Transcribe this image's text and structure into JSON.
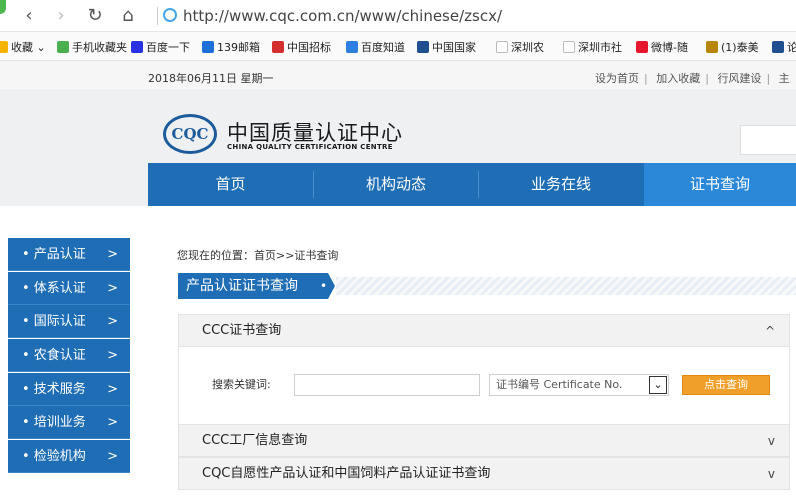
{
  "browser": {
    "url": "http://www.cqc.com.cn/www/chinese/zscx/",
    "back_glyph": "‹",
    "forward_glyph": "›",
    "refresh_glyph": "↻",
    "home_glyph": "⌂"
  },
  "favorites": [
    {
      "label": "收藏",
      "icon": "star-icon",
      "color": "#f4b400"
    },
    {
      "label": "手机收藏夹",
      "icon": "phone-icon",
      "color": "#4caf50"
    },
    {
      "label": "百度一下",
      "icon": "baidu-icon",
      "color": "#2932e1"
    },
    {
      "label": "139邮箱",
      "icon": "mail-icon",
      "color": "#1e6fd9"
    },
    {
      "label": "中国招标",
      "icon": "flag-icon",
      "color": "#d32f2f"
    },
    {
      "label": "百度知道",
      "icon": "paw-icon",
      "color": "#2f7fe0"
    },
    {
      "label": "中国国家",
      "icon": "site-icon",
      "color": "#1f4f8f"
    },
    {
      "label": "深圳农",
      "icon": "page-icon",
      "color": "#bbbbbb"
    },
    {
      "label": "深圳市社",
      "icon": "page-icon",
      "color": "#bbbbbb"
    },
    {
      "label": "微博-随",
      "icon": "weibo-icon",
      "color": "#e6162d"
    },
    {
      "label": "(1)泰美",
      "icon": "site-icon",
      "color": "#b8860b"
    },
    {
      "label": "论",
      "icon": "site-icon",
      "color": "#1f4f8f"
    }
  ],
  "topstrip": {
    "date": "2018年06月11日  星期一",
    "links": [
      "设为首页",
      "加入收藏",
      "行风建设",
      "主"
    ]
  },
  "logo": {
    "mark": "CQC",
    "name_cn": "中国质量认证中心",
    "name_en": "CHINA QUALITY CERTIFICATION CENTRE"
  },
  "mainnav": [
    {
      "label": "首页"
    },
    {
      "label": "机构动态"
    },
    {
      "label": "业务在线"
    },
    {
      "label": "证书查询",
      "active": true
    }
  ],
  "sidebar": {
    "items": [
      {
        "label": "• 产品认证"
      },
      {
        "label": "• 体系认证"
      },
      {
        "label": "• 国际认证"
      },
      {
        "label": "• 农食认证"
      },
      {
        "label": "• 技术服务"
      },
      {
        "label": "• 培训业务"
      },
      {
        "label": "• 检验机构"
      }
    ],
    "chevron": ">"
  },
  "content": {
    "breadcrumb": "您现在的位置：首页>>证书查询",
    "section_title": "产品认证证书查询",
    "section_dot": "•",
    "accordions": [
      {
        "title": "CCC证书查询",
        "chevron": "^"
      },
      {
        "title": "CCC工厂信息查询",
        "chevron": "v"
      },
      {
        "title": "CQC自愿性产品认证和中国饲料产品认证证书查询",
        "chevron": "v"
      }
    ],
    "search": {
      "keyword_label": "搜索关键词:",
      "keyword_value": "",
      "select_value": "证书编号 Certificate No.",
      "select_arrow": "⌄",
      "button_label": "点击查询"
    }
  }
}
